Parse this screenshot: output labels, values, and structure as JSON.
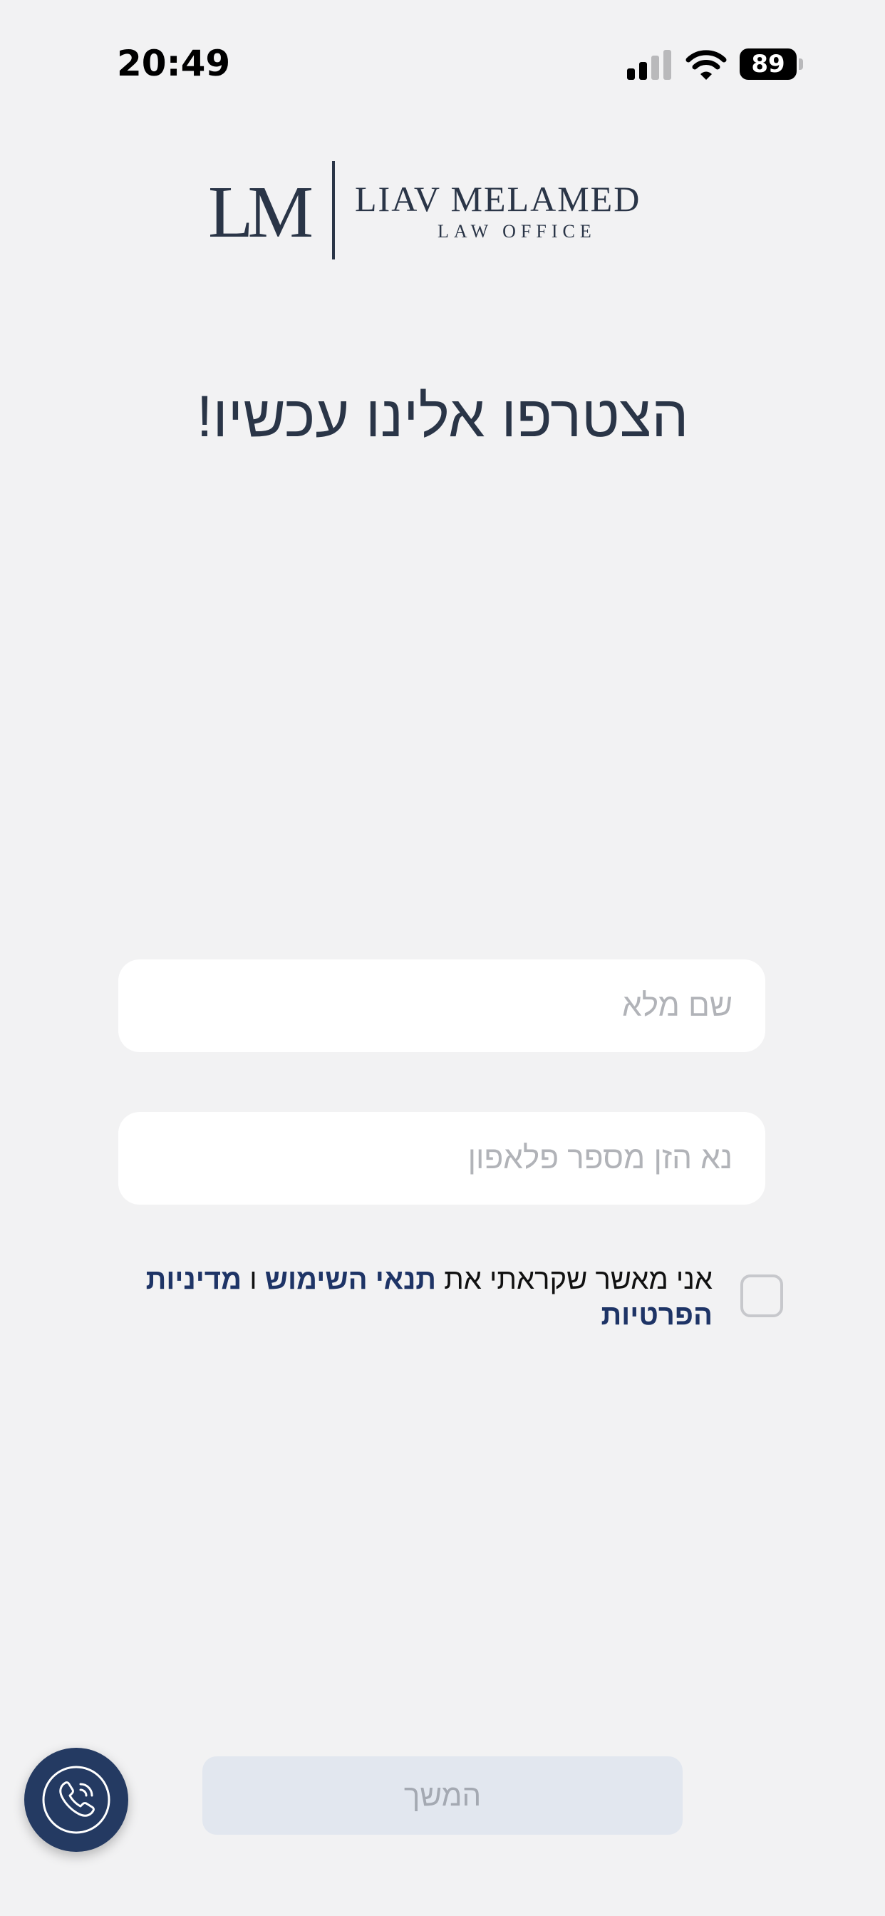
{
  "status_bar": {
    "time": "20:49",
    "battery_level": "89",
    "icons": [
      "signal-icon",
      "wifi-icon",
      "battery-icon"
    ]
  },
  "logo": {
    "monogram": "LM",
    "name": "LIAV MELAMED",
    "subtitle": "LAW OFFICE"
  },
  "headline": "הצטרפו אלינו עכשיו!",
  "form": {
    "full_name": {
      "value": "",
      "placeholder": "שם מלא"
    },
    "phone": {
      "value": "",
      "placeholder": "נא הזן מספר פלאפון"
    }
  },
  "consent": {
    "checked": false,
    "prefix": "אני מאשר שקראתי את",
    "terms_link": "תנאי השימוש",
    "joiner": "ו",
    "privacy_link": "מדיניות הפרטיות"
  },
  "continue_label": "המשך",
  "call_button": {
    "icon": "phone-call-icon"
  },
  "colors": {
    "background": "#f2f2f3",
    "primary": "#243a62",
    "text": "#2a3547",
    "link": "#1e3466",
    "disabled_button": "#e2e7ef",
    "disabled_text": "#a4a9b2"
  }
}
